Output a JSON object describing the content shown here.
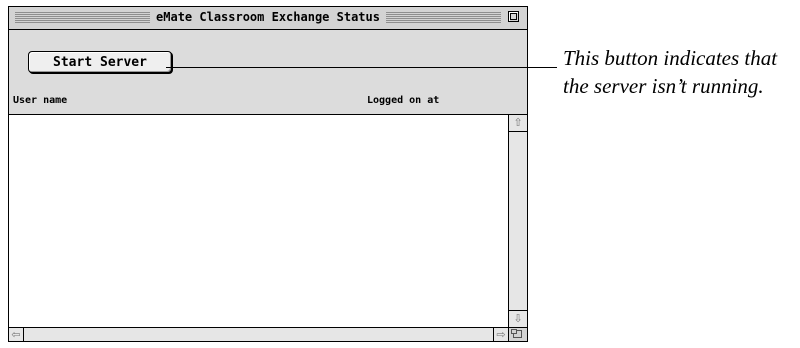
{
  "window": {
    "title": "eMate Classroom Exchange Status"
  },
  "header": {
    "start_server_label": "Start Server",
    "columns": {
      "user_name": "User name",
      "logged_on_at": "Logged on at"
    }
  },
  "list": {
    "rows": []
  },
  "scrollbars": {
    "up_arrow": "⇧",
    "down_arrow": "⇩",
    "left_arrow": "⇦",
    "right_arrow": "⇨"
  },
  "callout": {
    "line1": "This button indicates that",
    "line2": "the server isn’t running."
  },
  "icons": {
    "zoom_box": "zoom-box-icon",
    "grow_box": "grow-box-icon"
  }
}
